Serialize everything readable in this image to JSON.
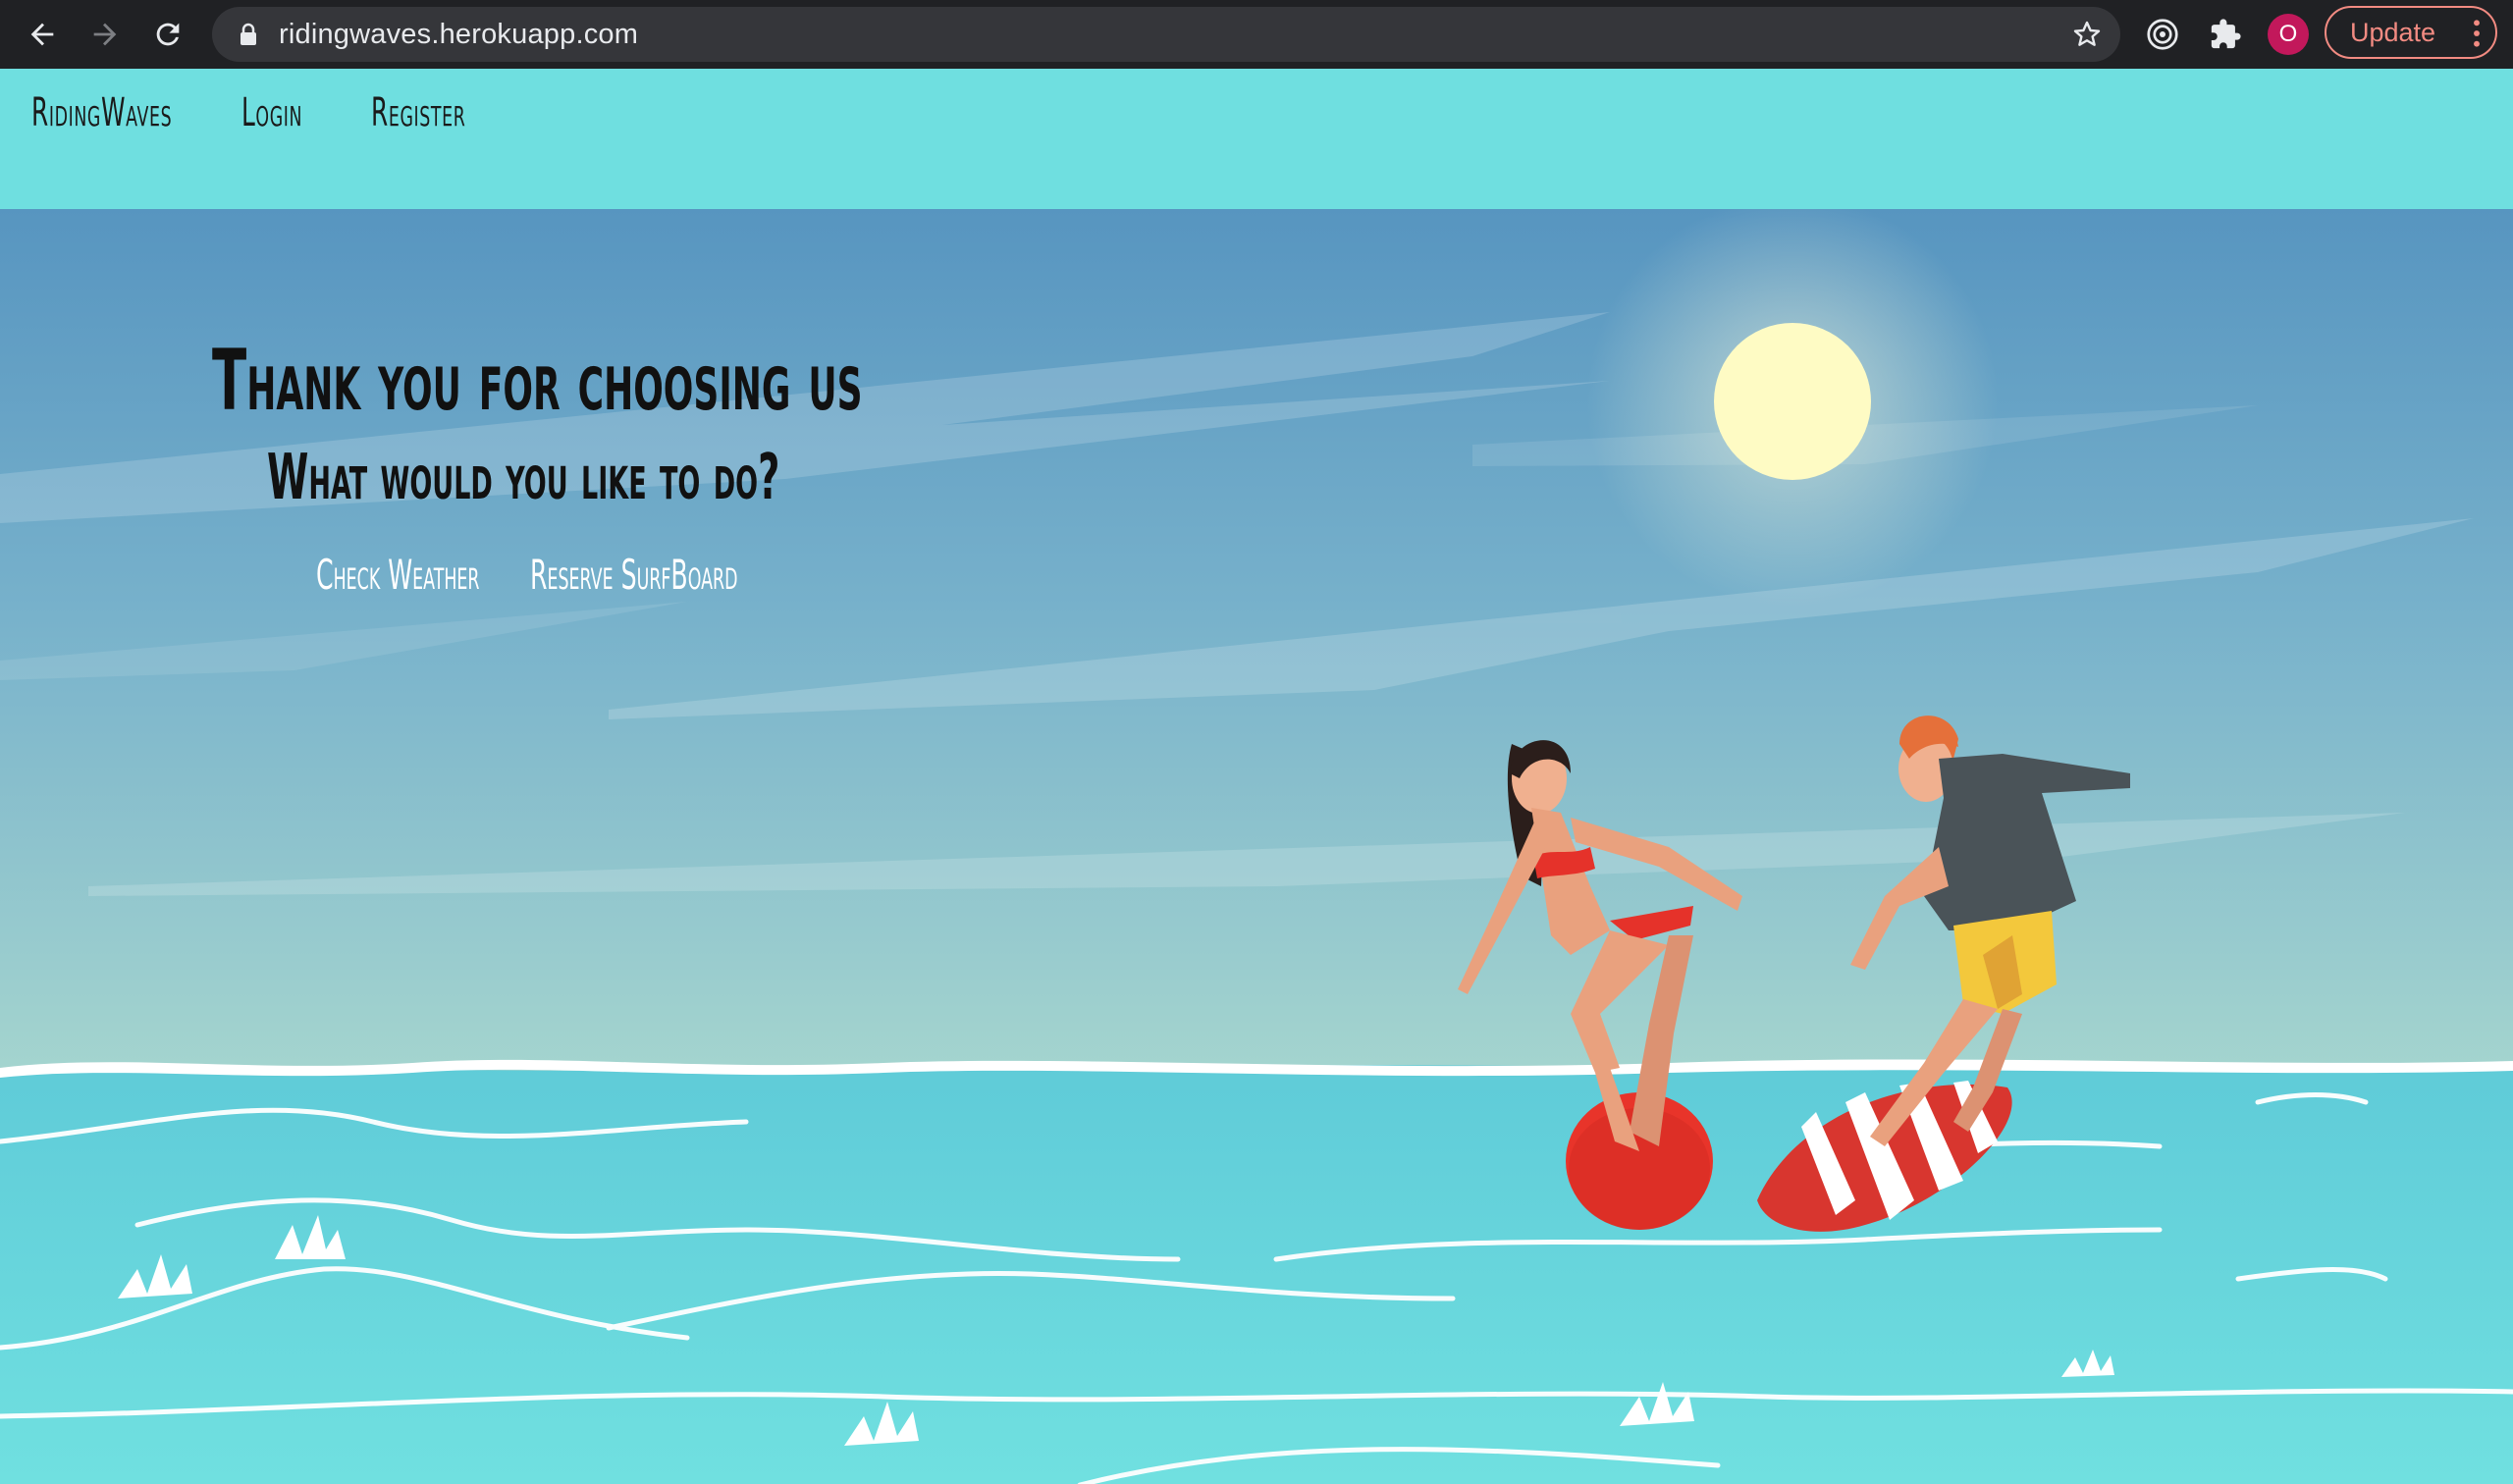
{
  "browser": {
    "url": "ridingwaves.herokuapp.com",
    "profile_initial": "O",
    "update_label": "Update",
    "icons": [
      "back-icon",
      "forward-icon",
      "reload-icon",
      "lock-icon",
      "star-icon",
      "target-icon",
      "puzzle-icon",
      "kebab-menu-icon"
    ]
  },
  "nav": {
    "brand": "RidingWaves",
    "items": [
      {
        "label": "Login"
      },
      {
        "label": "Register"
      }
    ]
  },
  "hero": {
    "title": "Thank you for choosing us",
    "subtitle": "What would you like to do?",
    "actions": [
      {
        "label": "Check Weather"
      },
      {
        "label": "Reserve SurfBoard"
      }
    ]
  },
  "colors": {
    "nav_bg": "#6fdfe0",
    "sky_top": "#5a9bc4",
    "sky_bottom": "#9fd0cf",
    "sea": "#5fd2de",
    "sun": "#fefbc4",
    "chrome_bg": "#202124",
    "profile": "#c2185b",
    "update_accent": "#f28b82"
  }
}
